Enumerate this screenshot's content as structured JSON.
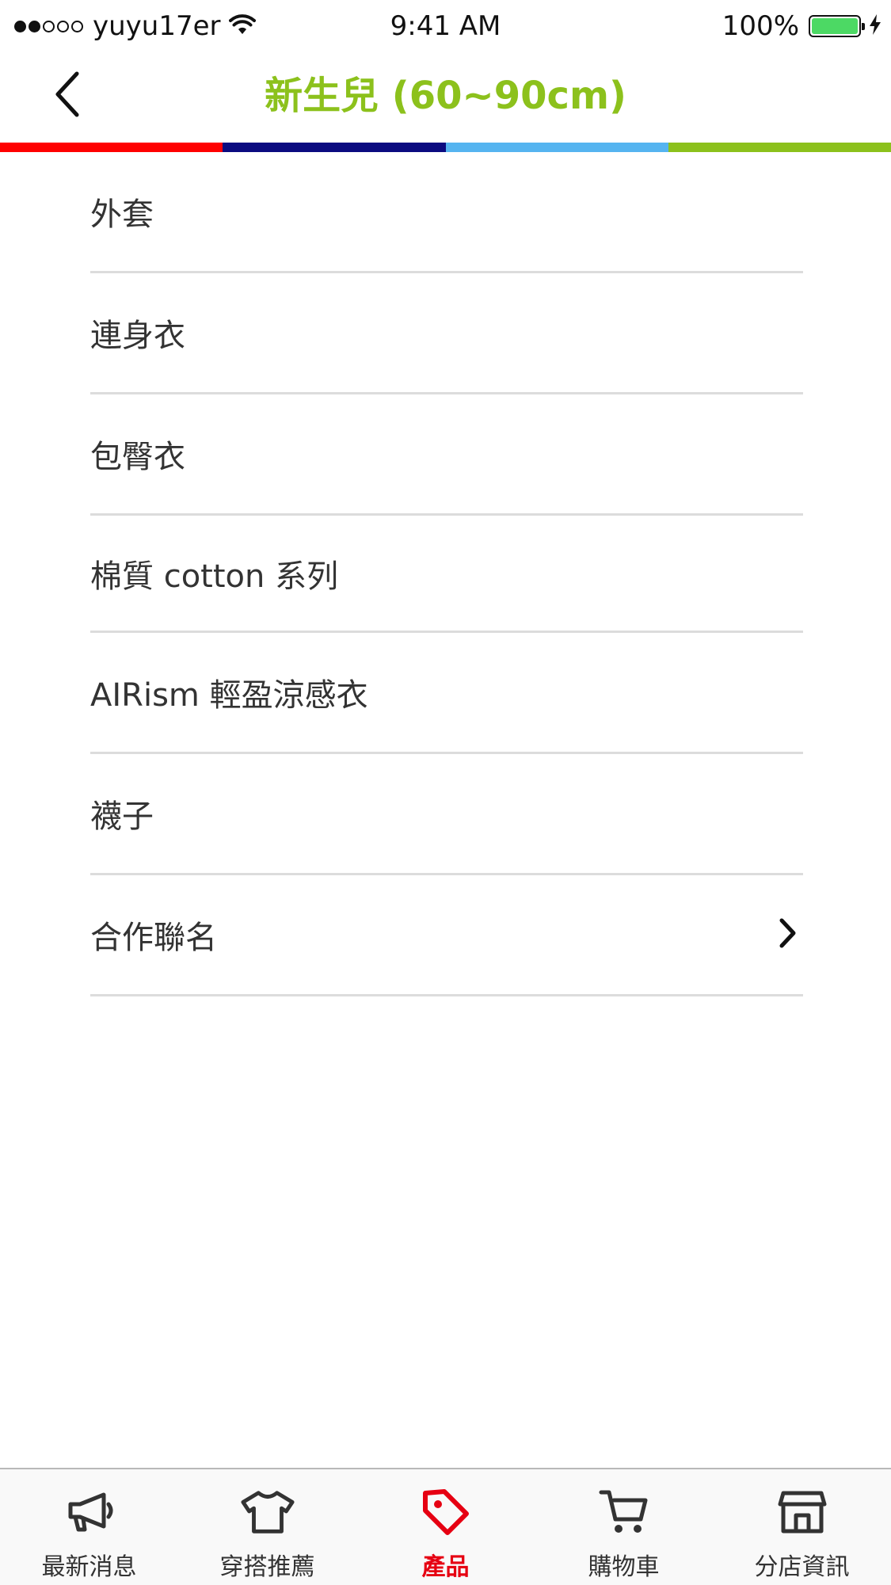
{
  "status_bar": {
    "signal_dots_filled": 2,
    "signal_dots_total": 5,
    "carrier": "yuyu17er",
    "wifi_icon": "wifi-icon",
    "time": "9:41 AM",
    "battery_percent": "100%",
    "battery_level": 1.0,
    "charging_icon": "bolt-icon"
  },
  "nav": {
    "back_icon": "chevron-left-icon",
    "title": "新生兒 (60~90cm)",
    "title_color": "#8cc11c"
  },
  "color_strip": [
    "#ff0000",
    "#0b0b80",
    "#55b4f0",
    "#8cc11c"
  ],
  "categories": [
    {
      "label": "外套",
      "has_chevron": false
    },
    {
      "label": "連身衣",
      "has_chevron": false
    },
    {
      "label": "包臀衣",
      "has_chevron": false
    },
    {
      "label": "棉質 cotton 系列",
      "has_chevron": false
    },
    {
      "label": "AIRism 輕盈涼感衣",
      "has_chevron": false
    },
    {
      "label": "襪子",
      "has_chevron": false
    },
    {
      "label": "合作聯名",
      "has_chevron": true
    }
  ],
  "tabs": [
    {
      "label": "最新消息",
      "icon": "megaphone-icon",
      "active": false
    },
    {
      "label": "穿搭推薦",
      "icon": "tshirt-icon",
      "active": false
    },
    {
      "label": "產品",
      "icon": "tag-icon",
      "active": true
    },
    {
      "label": "購物車",
      "icon": "cart-icon",
      "active": false
    },
    {
      "label": "分店資訊",
      "icon": "store-icon",
      "active": false
    }
  ],
  "colors": {
    "active_tab": "#e60012",
    "inactive_tab": "#333333"
  }
}
